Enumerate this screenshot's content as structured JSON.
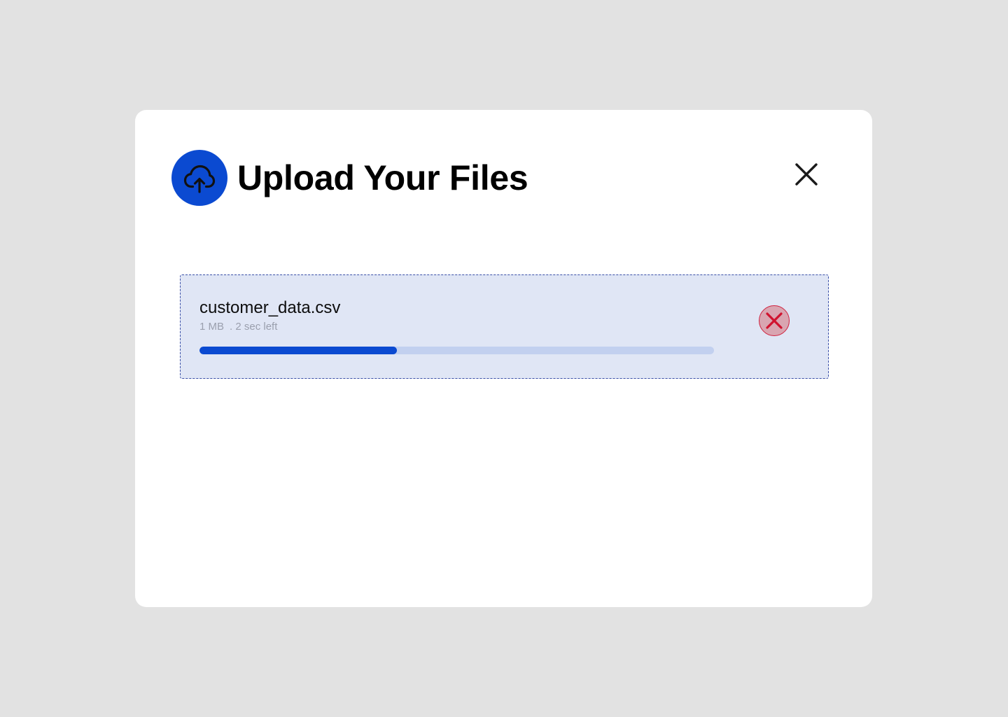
{
  "dialog": {
    "title": "Upload Your Files",
    "header_icon": "cloud-upload-icon",
    "close_icon": "close-icon"
  },
  "upload_item": {
    "file_name": "customer_data.csv",
    "size": "1 MB",
    "separator": ".",
    "time_left": "2 sec left",
    "progress_fraction": 0.384,
    "cancel_icon": "cancel-x-icon"
  },
  "colors": {
    "background": "#e2e2e2",
    "modal": "#ffffff",
    "accent": "#0b4ad1",
    "card_background": "#e0e6f5",
    "card_border": "#3a4fa8",
    "progress_track": "#c2d0ef",
    "progress_fill": "#0b4ad1",
    "cancel_background": "#d9a5b1",
    "cancel_border": "#d0213f",
    "cancel_icon": "#d0132f",
    "meta_text": "#9a9fad"
  }
}
